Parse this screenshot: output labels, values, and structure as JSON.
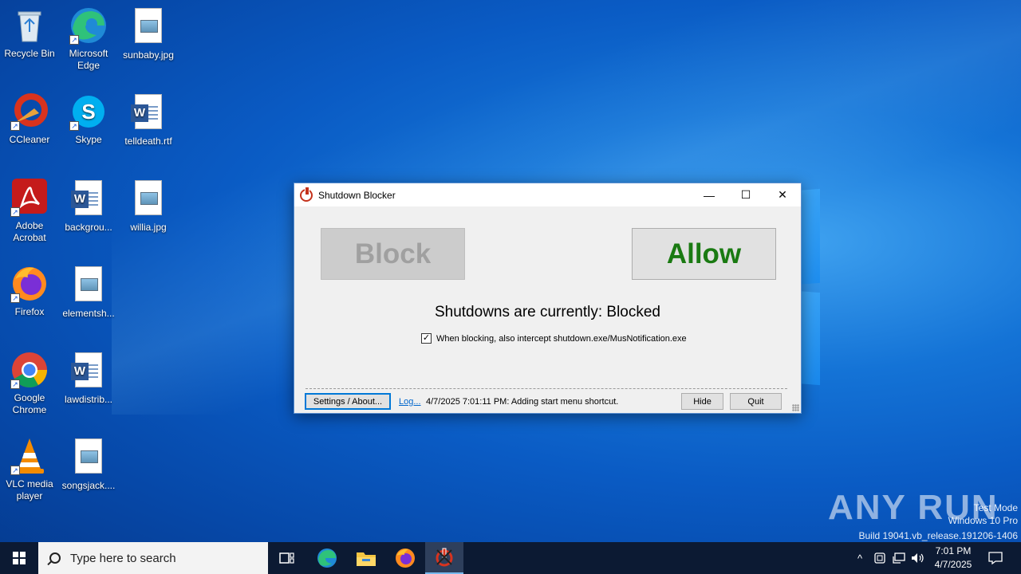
{
  "desktop": {
    "icons": [
      {
        "label": "Recycle Bin",
        "icon": "recycle-bin-icon"
      },
      {
        "label": "Microsoft Edge",
        "icon": "edge-icon"
      },
      {
        "label": "sunbaby.jpg",
        "icon": "image-file-icon"
      },
      {
        "label": "CCleaner",
        "icon": "ccleaner-icon"
      },
      {
        "label": "Skype",
        "icon": "skype-icon"
      },
      {
        "label": "telldeath.rtf",
        "icon": "word-file-icon"
      },
      {
        "label": "Adobe Acrobat",
        "icon": "acrobat-icon"
      },
      {
        "label": "backgrou...",
        "icon": "word-file-icon"
      },
      {
        "label": "willia.jpg",
        "icon": "image-file-icon"
      },
      {
        "label": "Firefox",
        "icon": "firefox-icon"
      },
      {
        "label": "elementsh...",
        "icon": "image-file-icon"
      },
      {
        "label": "Google Chrome",
        "icon": "chrome-icon"
      },
      {
        "label": "lawdistrib...",
        "icon": "word-file-icon"
      },
      {
        "label": "VLC media player",
        "icon": "vlc-icon"
      },
      {
        "label": "songsjack....",
        "icon": "image-file-icon"
      }
    ]
  },
  "window": {
    "title": "Shutdown Blocker",
    "block_label": "Block",
    "allow_label": "Allow",
    "status_text": "Shutdowns are currently: Blocked",
    "checkbox_label": "When blocking, also intercept shutdown.exe/MusNotification.exe",
    "checkbox_checked": true,
    "settings_label": "Settings / About...",
    "log_link": "Log...",
    "log_message": "4/7/2025 7:01:11 PM: Adding start menu shortcut.",
    "hide_label": "Hide",
    "quit_label": "Quit",
    "minimize_glyph": "—",
    "maximize_glyph": "☐",
    "close_glyph": "✕",
    "colors": {
      "allow_text": "#1a7a12",
      "block_text": "#a0a0a0"
    }
  },
  "watermark": {
    "logo": "ANY RUN",
    "line1": "Test Mode",
    "line2": "Windows 10 Pro",
    "line3": "Build 19041.vb_release.191206-1406"
  },
  "taskbar": {
    "search_placeholder": "Type here to search",
    "pinned": [
      "task-view-icon",
      "edge-icon",
      "file-explorer-icon",
      "firefox-icon",
      "shutdown-blocker-icon"
    ],
    "tray_chevron": "^",
    "clock_time": "7:01 PM",
    "clock_date": "4/7/2025"
  }
}
